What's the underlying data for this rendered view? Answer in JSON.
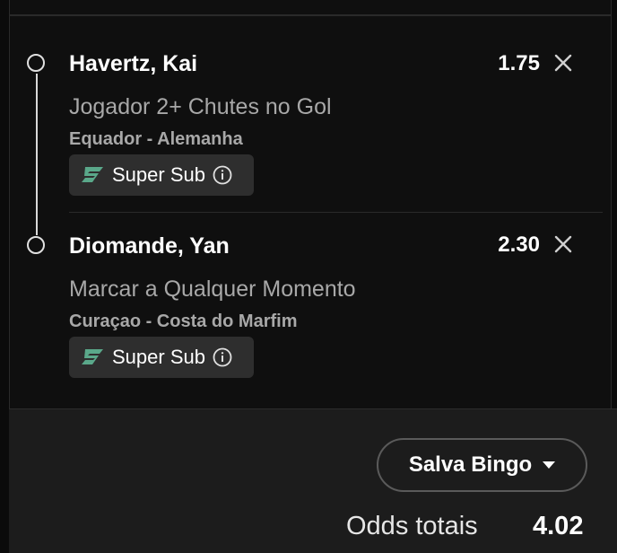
{
  "selections": [
    {
      "player": "Havertz, Kai",
      "odds": "1.75",
      "market": "Jogador 2+ Chutes no Gol",
      "match": "Equador - Alemanha",
      "badge_label": "Super Sub",
      "badge_icon": "super-sub-icon",
      "close_icon": "close-icon"
    },
    {
      "player": "Diomande, Yan",
      "odds": "2.30",
      "market": "Marcar a Qualquer Momento",
      "match": "Curaçao - Costa do Marfim",
      "badge_label": "Super Sub",
      "badge_icon": "super-sub-icon",
      "close_icon": "close-icon"
    }
  ],
  "footer": {
    "bingo_button_label": "Salva Bingo",
    "odds_label": "Odds totais",
    "odds_total": "4.02"
  },
  "colors": {
    "background": "#0f0f0f",
    "footer_background": "#1c1c1c",
    "badge_background": "#2e2e2e",
    "badge_icon": "#5aa88a",
    "muted_text": "#a8a8a8"
  }
}
